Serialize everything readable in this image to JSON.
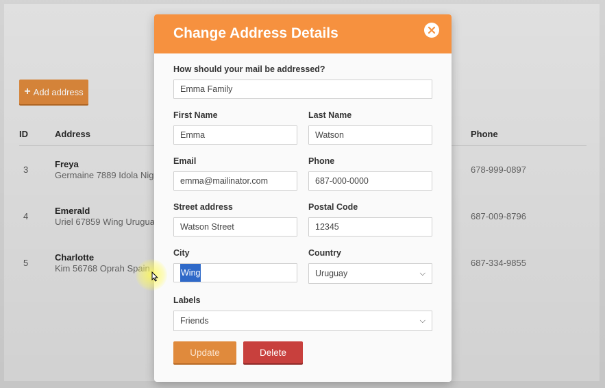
{
  "background": {
    "add_button_label": "Add address",
    "table": {
      "headers": {
        "id": "ID",
        "address": "Address",
        "phone": "Phone"
      },
      "rows": [
        {
          "id": "3",
          "name": "Freya",
          "address": "Germaine 7889 Idola Niger",
          "phone": "678-999-0897"
        },
        {
          "id": "4",
          "name": "Emerald",
          "address": "Uriel 67859 Wing Uruguay",
          "phone": "687-009-8796"
        },
        {
          "id": "5",
          "name": "Charlotte",
          "address": "Kim 56768 Oprah Spain",
          "phone": "687-334-9855"
        }
      ]
    }
  },
  "modal": {
    "title": "Change Address Details",
    "addressed_label": "How should your mail be addressed?",
    "addressed_value": "Emma Family",
    "first_name_label": "First Name",
    "first_name_value": "Emma",
    "last_name_label": "Last Name",
    "last_name_value": "Watson",
    "email_label": "Email",
    "email_value": "emma@mailinator.com",
    "phone_label": "Phone",
    "phone_value": "687-000-0000",
    "street_label": "Street address",
    "street_value": "Watson Street",
    "postal_label": "Postal Code",
    "postal_value": "12345",
    "city_label": "City",
    "city_value": "Wing",
    "country_label": "Country",
    "country_value": "Uruguay",
    "labels_label": "Labels",
    "labels_value": "Friends",
    "update_label": "Update",
    "delete_label": "Delete"
  },
  "colors": {
    "header": "#f6913f",
    "update": "#e08a3c",
    "delete": "#c8403d",
    "selection": "#2f69c8"
  }
}
